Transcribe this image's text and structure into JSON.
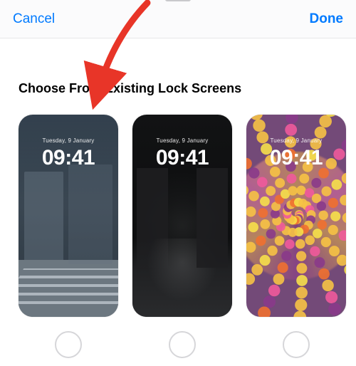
{
  "nav": {
    "cancel": "Cancel",
    "done": "Done"
  },
  "section": {
    "title": "Choose From Existing Lock Screens"
  },
  "screens": [
    {
      "date": "Tuesday, 9 January",
      "time": "09:41"
    },
    {
      "date": "Tuesday, 9 January",
      "time": "09:41"
    },
    {
      "date": "Tuesday, 9 January",
      "time": "09:41"
    }
  ],
  "colors": {
    "accent": "#007aff",
    "annotation": "#e83528"
  }
}
